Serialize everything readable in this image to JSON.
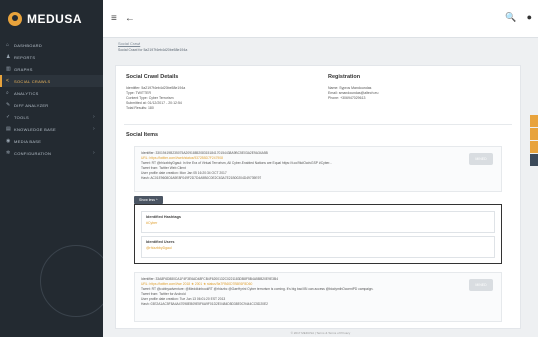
{
  "brand": {
    "name": "MEDUSA"
  },
  "sidebar": {
    "items": [
      {
        "label": "DASHBOARD",
        "icon": "home-icon",
        "glyph": "⌂",
        "active": false
      },
      {
        "label": "REPORTS",
        "icon": "person-icon",
        "glyph": "♟",
        "active": false
      },
      {
        "label": "GRAPHS",
        "icon": "chart-icon",
        "glyph": "▥",
        "active": false
      },
      {
        "label": "SOCIAL CRAWLS",
        "icon": "share-icon",
        "glyph": "<",
        "active": true
      },
      {
        "label": "ANALYTICS",
        "icon": "search-icon",
        "glyph": "⌕",
        "active": false
      },
      {
        "label": "DIFF ANALYZER",
        "icon": "edit-icon",
        "glyph": "✎",
        "active": false
      },
      {
        "label": "TOOLS",
        "icon": "wrench-icon",
        "glyph": "✓",
        "active": false,
        "caret": "›"
      },
      {
        "label": "KNOWLEDGE BASE",
        "icon": "book-icon",
        "glyph": "▤",
        "active": false,
        "caret": "›"
      },
      {
        "label": "MEDIA BASE",
        "icon": "media-icon",
        "glyph": "◉",
        "active": false
      },
      {
        "label": "CONFIGURATION",
        "icon": "settings-icon",
        "glyph": "✲",
        "active": false,
        "caret": "›"
      }
    ]
  },
  "topbar": {
    "menu_glyph": "≡",
    "back_glyph": "←",
    "search_glyph": "🔍",
    "user_glyph": "●"
  },
  "page": {
    "breadcrumb": "Social Crawl",
    "subtitle": "Social Crawl for 5a2197f4eb4d20be58e194a"
  },
  "details": {
    "title": "Social Crawl Details",
    "lines": [
      "Identifier: 5a2197f4eb4d20be58e194a",
      "Type: TWITTER",
      "Content Type: Cyber Terrorism",
      "Submitted at: 01/12/2017 - 20:12:54",
      "Total Results: 180"
    ]
  },
  "registration": {
    "title": "Registration",
    "lines": [
      "Name: Sypros Mandoundas",
      "Email: smandoundas@altech.eu",
      "Phone: +306947029613"
    ]
  },
  "social_items": {
    "title": "Social Items",
    "items": [
      {
        "lines": [
          "Identifier: 33019419B235075A2091885208315184170154438A9BC5E03A2E9A34A5B",
          "URL: https://twitter.com/i/web/status/9372B5D7F247908",
          "Tweet: RT @rhizzbbyDgaul: In the Era of Virtual Terrorism, All Cyber-Enabled Nations are Equal https://t.co/9kdOcdvGSP #Cyber...",
          "Tweet from: Twitter Web Client",
          "User profile date creation: Mon Jan 05 16:20:34 OCT 2017",
          "Hash: AC01E9608C6A9E8F049F2D7D4A9B0C0E2C63A7E21B00204D49739E97"
        ],
        "button": "MINED"
      },
      {
        "lines": [
          "Identifier: 33A8F6D880CA1F4F3E6AD48FCB4F6200132C0221183DB8F5B4A5BB20E9E3B4",
          "URL: https://twitter.com/i/we 2018 ★ 2001 ★ status/9a7FB60D7B5E6F8D60",
          "Tweet: RT @cobbyadventure: @MeddkinbookRT @rhizzbc @GaeHyrini Cyber terrorism is coming. It's big bad IBI can access @biodymihOccentPD campaign.",
          "Tweet from: Twitter for Android",
          "User profile date creation: Tue Jun 13 06:01:20 EST 2013",
          "Hash: 03E2A1AC5F8A4A47098EB09E5F6A9F01D2E0484D5D38E0C9444CC5D20E2"
        ],
        "button": "MINED"
      }
    ]
  },
  "identified": {
    "show_label": "Show less ^",
    "hashtags_label": "Identified Hashtags",
    "hashtags_value": "#Cyber",
    "users_label": "Identified Users",
    "users_value": "@rhizzbbyDgaul"
  },
  "footer": {
    "text": "© 2017 MEDUSA | Terms & Terms of Privacy"
  },
  "colors": {
    "accent": "#e8a33c",
    "sidebar": "#232a31"
  }
}
